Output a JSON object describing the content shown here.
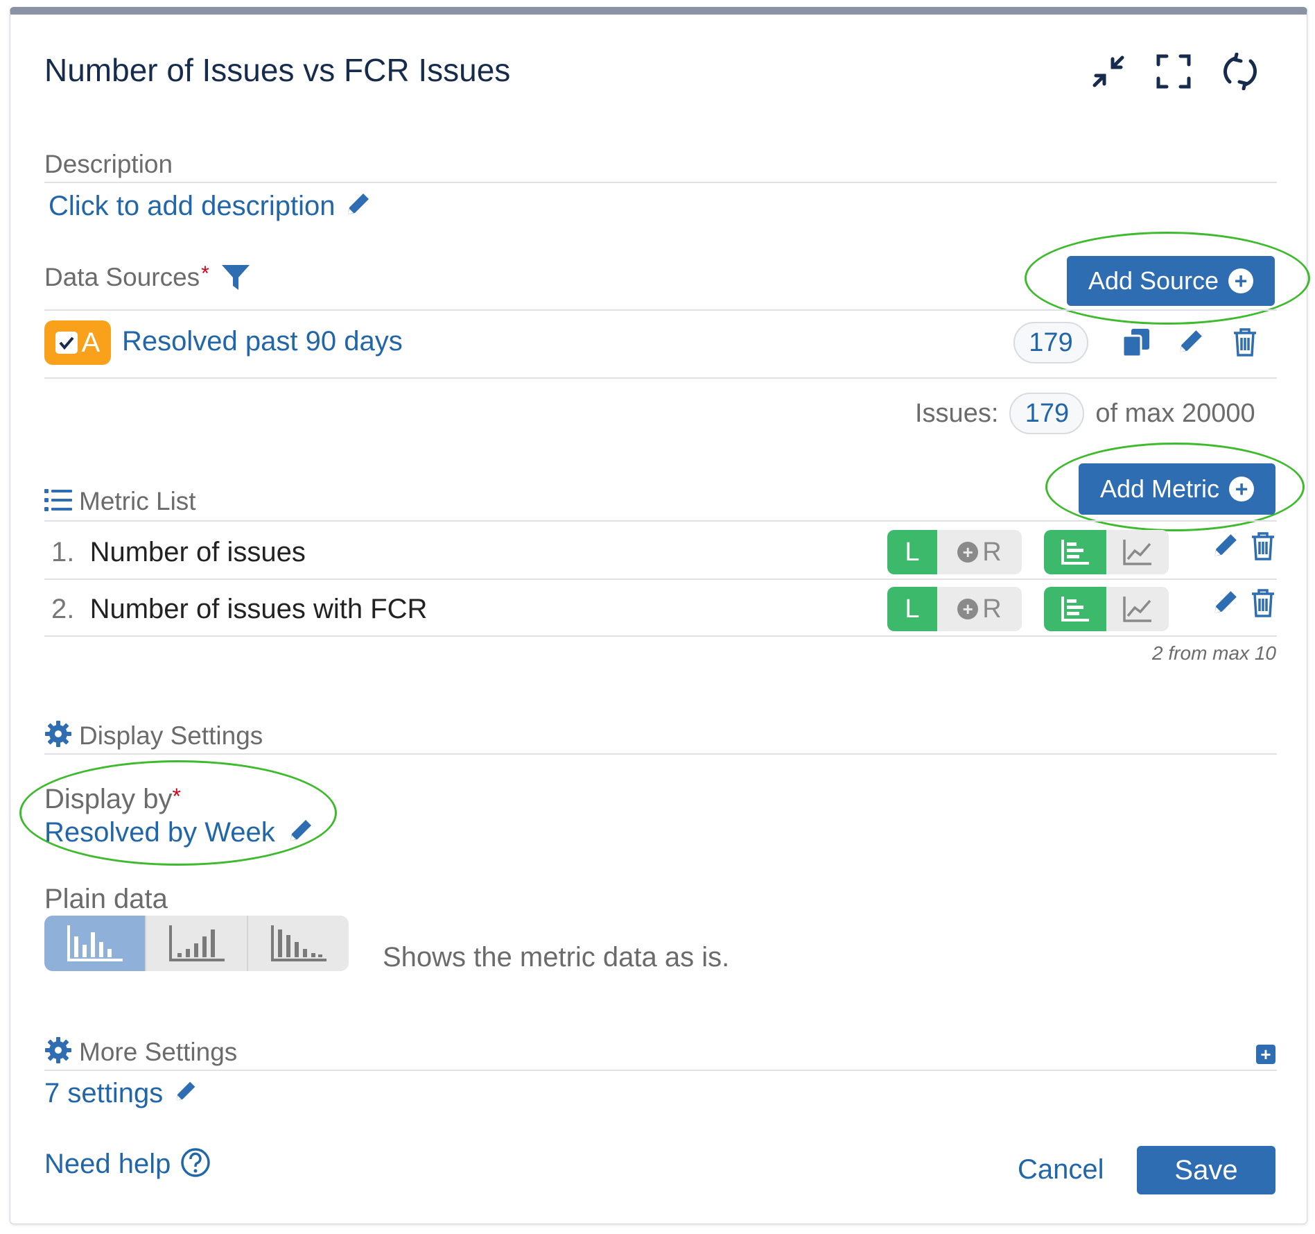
{
  "header": {
    "title": "Number of Issues vs FCR Issues"
  },
  "description": {
    "label": "Description",
    "placeholder_link": "Click to add description"
  },
  "data_sources": {
    "label": "Data Sources",
    "required_marker": "*",
    "add_button": "Add Source",
    "items": [
      {
        "badge_letter": "A",
        "checked": true,
        "name": "Resolved past 90 days",
        "count": "179"
      }
    ],
    "issues_label": "Issues:",
    "issues_count": "179",
    "issues_max_text": "of max 20000"
  },
  "metrics": {
    "label": "Metric List",
    "add_button": "Add Metric",
    "items": [
      {
        "index": "1.",
        "name": "Number of issues",
        "axis_left": "L",
        "axis_right": "R"
      },
      {
        "index": "2.",
        "name": "Number of issues with FCR",
        "axis_left": "L",
        "axis_right": "R"
      }
    ],
    "count_text": "2 from max 10"
  },
  "display_settings": {
    "label": "Display Settings",
    "display_by_label": "Display by",
    "required_marker": "*",
    "display_by_value": "Resolved by Week",
    "plain_data_label": "Plain data",
    "plain_data_description": "Shows the metric data as is."
  },
  "more_settings": {
    "label": "More Settings",
    "value": "7 settings"
  },
  "footer": {
    "help_text": "Need help",
    "cancel_label": "Cancel",
    "save_label": "Save"
  },
  "colors": {
    "primary": "#2f6db3",
    "link": "#2166a8",
    "source_badge": "#f9a11b",
    "axis_active": "#3cb96a",
    "highlight_ellipse": "#3dbb2c",
    "required": "#d0021b"
  }
}
